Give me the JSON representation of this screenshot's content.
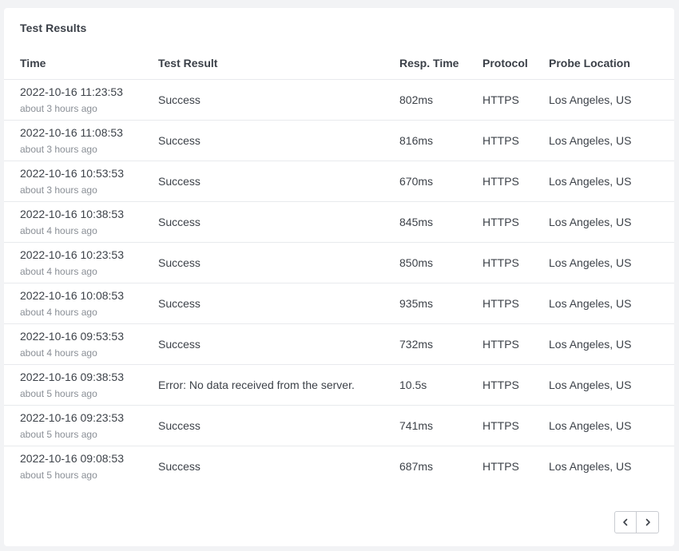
{
  "card": {
    "title": "Test Results"
  },
  "columns": {
    "time": "Time",
    "result": "Test Result",
    "resp_time": "Resp. Time",
    "protocol": "Protocol",
    "location": "Probe Location"
  },
  "rows": [
    {
      "time": "2022-10-16 11:23:53",
      "ago": "about 3 hours ago",
      "result": "Success",
      "resp_time": "802ms",
      "protocol": "HTTPS",
      "location": "Los Angeles, US"
    },
    {
      "time": "2022-10-16 11:08:53",
      "ago": "about 3 hours ago",
      "result": "Success",
      "resp_time": "816ms",
      "protocol": "HTTPS",
      "location": "Los Angeles, US"
    },
    {
      "time": "2022-10-16 10:53:53",
      "ago": "about 3 hours ago",
      "result": "Success",
      "resp_time": "670ms",
      "protocol": "HTTPS",
      "location": "Los Angeles, US"
    },
    {
      "time": "2022-10-16 10:38:53",
      "ago": "about 4 hours ago",
      "result": "Success",
      "resp_time": "845ms",
      "protocol": "HTTPS",
      "location": "Los Angeles, US"
    },
    {
      "time": "2022-10-16 10:23:53",
      "ago": "about 4 hours ago",
      "result": "Success",
      "resp_time": "850ms",
      "protocol": "HTTPS",
      "location": "Los Angeles, US"
    },
    {
      "time": "2022-10-16 10:08:53",
      "ago": "about 4 hours ago",
      "result": "Success",
      "resp_time": "935ms",
      "protocol": "HTTPS",
      "location": "Los Angeles, US"
    },
    {
      "time": "2022-10-16 09:53:53",
      "ago": "about 4 hours ago",
      "result": "Success",
      "resp_time": "732ms",
      "protocol": "HTTPS",
      "location": "Los Angeles, US"
    },
    {
      "time": "2022-10-16 09:38:53",
      "ago": "about 5 hours ago",
      "result": "Error: No data received from the server.",
      "resp_time": "10.5s",
      "protocol": "HTTPS",
      "location": "Los Angeles, US"
    },
    {
      "time": "2022-10-16 09:23:53",
      "ago": "about 5 hours ago",
      "result": "Success",
      "resp_time": "741ms",
      "protocol": "HTTPS",
      "location": "Los Angeles, US"
    },
    {
      "time": "2022-10-16 09:08:53",
      "ago": "about 5 hours ago",
      "result": "Success",
      "resp_time": "687ms",
      "protocol": "HTTPS",
      "location": "Los Angeles, US"
    }
  ],
  "pagination": {
    "prev_icon": "chevron-left-icon",
    "next_icon": "chevron-right-icon"
  }
}
